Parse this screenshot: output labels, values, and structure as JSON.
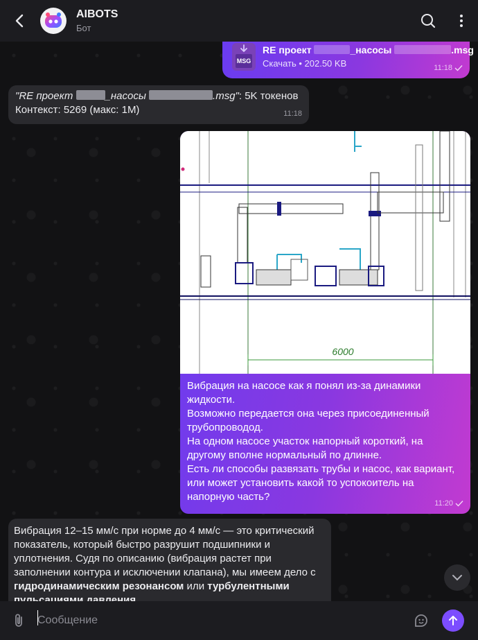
{
  "header": {
    "title": "AIBOTS",
    "subtitle": "Бот"
  },
  "file_message": {
    "name_prefix": "RE проект",
    "name_middle": "_насосы",
    "name_suffix": ".msg",
    "file_ext": "MSG",
    "meta": "Скачать • 202.50 KB",
    "time": "11:18"
  },
  "info_message": {
    "quote_prefix": "\"RE проект",
    "quote_middle": "_насосы",
    "quote_suffix": ".msg\"",
    "tokens": ": 5K токенов",
    "context": "Контекст: 5269 (макс: 1M)",
    "time": "11:18"
  },
  "photo_message": {
    "drawing_dimension": "6000",
    "text_lines": [
      "Вибрация на насосе как я понял из-за динамики жидкости.",
      "Возможно передается она через присоединенный трубопроводод.",
      "На одном насосе участок напорный короткий, на другому вполне нормальный по длинне.",
      "Есть ли способы развязать трубы и насос, как вариант, или может установить какой то успокоитель на напорную часть?"
    ],
    "time": "11:20"
  },
  "reply_message": {
    "text_main": "Вибрация 12–15 мм/с при норме до 4 мм/с — это критический показатель, который быстро разрушит подшипники и уплотнения. Судя по описанию (вибрация растет при заполнении контура и исключении клапана), мы имеем дело с ",
    "bold1": "гидродинамическим резонансом",
    "mid": " или ",
    "bold2": "турбулентными пульсациями давления",
    "end": "."
  },
  "composer": {
    "placeholder": "Сообщение"
  },
  "colors": {
    "accent": "#7c4dff",
    "outgoing_start": "#6a3cf0",
    "outgoing_end": "#c23ad0",
    "incoming": "#2a2a2e"
  },
  "icons": [
    "back-arrow-icon",
    "bot-logo-icon",
    "search-icon",
    "more-vertical-icon",
    "download-icon",
    "read-check-icon",
    "chevron-down-icon",
    "paperclip-icon",
    "sticker-icon",
    "send-arrow-icon"
  ]
}
